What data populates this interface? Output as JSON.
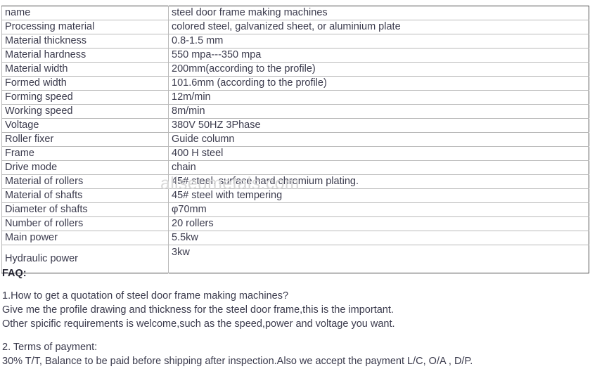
{
  "spec_table": {
    "rows": [
      {
        "key": "name",
        "value": "steel door frame making machines"
      },
      {
        "key": "Processing material",
        "value": "colored steel, galvanized sheet, or aluminium plate"
      },
      {
        "key": "Material thickness",
        "value": "0.8-1.5 mm"
      },
      {
        "key": "Material hardness",
        "value": "550 mpa---350 mpa"
      },
      {
        "key": "Material width",
        "value": "200mm(according to the profile)"
      },
      {
        "key": "Formed width",
        "value": "101.6mm (according to the profile)"
      },
      {
        "key": "Forming speed",
        "value": "12m/min"
      },
      {
        "key": "Working speed",
        "value": "8m/min"
      },
      {
        "key": "Voltage",
        "value": "380V 50HZ 3Phase"
      },
      {
        "key": "Roller fixer",
        "value": "Guide column"
      },
      {
        "key": "Frame",
        "value": "400 H steel"
      },
      {
        "key": "Drive mode",
        "value": "chain"
      },
      {
        "key": "Material of rollers",
        "value": "45# steel, surface hard chromium plating."
      },
      {
        "key": "Material of shafts",
        "value": "45# steel with tempering"
      },
      {
        "key": "Diameter of shafts",
        "value": "φ70mm"
      },
      {
        "key": "Number of rollers",
        "value": "20 rollers"
      },
      {
        "key": "Main power",
        "value": "5.5kw"
      },
      {
        "key": "Hydraulic power",
        "value": "3kw"
      }
    ]
  },
  "watermark": {
    "text": "allseumetals.com"
  },
  "faq": {
    "title": "FAQ:",
    "q1_line1": "1.How to get a quotation of steel door frame making machines?",
    "q1_line2": "Give me the profile drawing and thickness for the steel door frame,this is the important.",
    "q1_line3": "Other spicific requirements is welcome,such as the speed,power and voltage you want.",
    "q2_line1": "2. Terms of payment:",
    "q2_line2": "30% T/T, Balance to be paid before shipping after inspection.Also we accept the payment L/C, O/A , D/P."
  },
  "colors": {
    "text": "#3b3b4d",
    "heading": "#262633",
    "border_inner": "#b9b9b9",
    "border_outer": "#4a4a4a",
    "watermark": "#d8d8d8",
    "background": "#ffffff"
  }
}
